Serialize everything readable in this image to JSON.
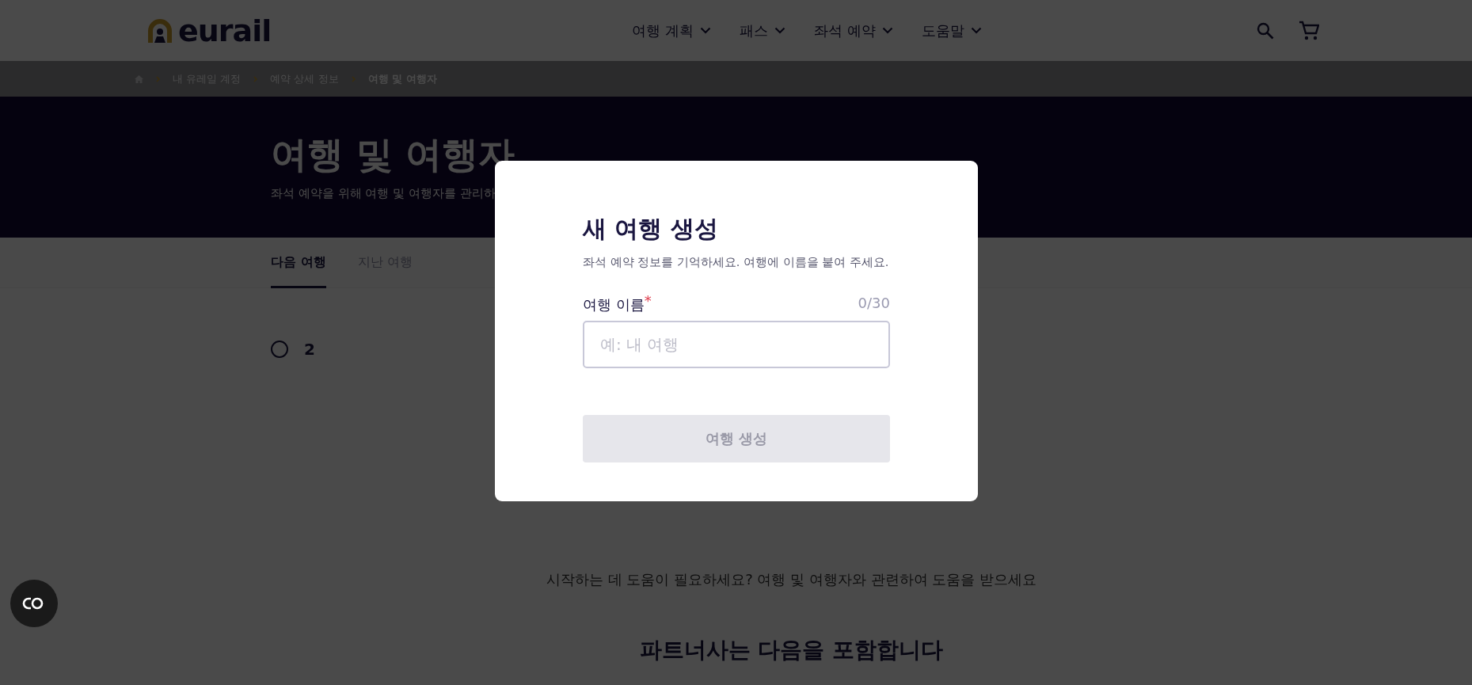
{
  "header": {
    "logo": "eurail",
    "nav": [
      {
        "label": "여행 계획"
      },
      {
        "label": "패스"
      },
      {
        "label": "좌석 예약"
      },
      {
        "label": "도움말"
      }
    ]
  },
  "breadcrumb": [
    {
      "label": "내 유레일 계정"
    },
    {
      "label": "예약 상세 정보"
    },
    {
      "label": "여행 및 여행자"
    }
  ],
  "hero": {
    "title": "여행 및 여행자",
    "subtitle": "좌석 예약을 위해 여행 및 여행자를 관리하"
  },
  "tabs": [
    {
      "label": "다음 여행",
      "selected": true
    },
    {
      "label": "지난 여행",
      "selected": false
    }
  ],
  "trips": [
    {
      "selected": false,
      "text": "2"
    }
  ],
  "help": {
    "text": "시작하는 데 도움이 필요하세요?",
    "link": "여행 및 여행자와 관련하여 도움을 받으세요"
  },
  "partners_heading": "파트너사는 다음을 포함합니다",
  "modal": {
    "title": "새 여행 생성",
    "description": "좌석 예약 정보를 기억하세요. 여행에 이름을 붙여 주세요.",
    "field": {
      "label": "여행 이름",
      "required_mark": "*",
      "counter": "0/30",
      "placeholder": "예: 내 여행"
    },
    "button": {
      "label": "여행 생성",
      "disabled": true
    }
  }
}
